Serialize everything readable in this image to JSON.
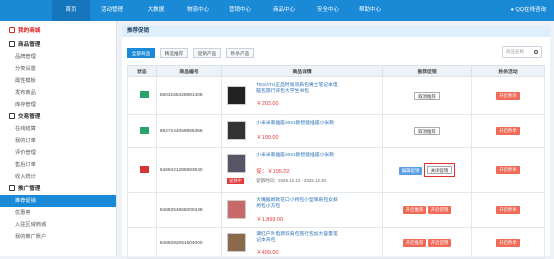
{
  "topnav": {
    "items": [
      "首页",
      "活动管理",
      "大数据",
      "物流中心",
      "营销中心",
      "商品中心",
      "安全中心",
      "帮助中心"
    ],
    "qq_label": "QQ在线咨询"
  },
  "sidebar": {
    "my_shop": "我的商城",
    "sections": [
      {
        "title": "商品管理",
        "items": [
          "品牌管理",
          "分类设置",
          "属性模板",
          "发布商品",
          "库存管理"
        ]
      },
      {
        "title": "交易管理",
        "items": [
          "在线结算",
          "我的订单",
          "评价管理",
          "售后订单",
          "收入统计"
        ]
      },
      {
        "title": "推广管理",
        "items": [
          "推荐促销",
          "优惠券",
          "入驻区域商城",
          "我的推广账户"
        ]
      }
    ]
  },
  "main": {
    "breadcrumb": "推荐促销",
    "tabs": [
      "全部商品",
      "精选推荐",
      "促销产品",
      "秒杀产品"
    ],
    "search_placeholder": "商品名称",
    "columns": [
      "状态",
      "商品编号",
      "商品详情",
      "推荐促销",
      "秒杀活动"
    ],
    "rows": [
      {
        "status": "green",
        "code": "6503165428881408",
        "name": "TEGATU正品时尚双肩包男士笔记本电脑包旅行背包大学生书包",
        "price": "￥203.00",
        "promo": "取消推荐",
        "seckill": "开启秒杀"
      },
      {
        "status": "green",
        "code": "8527244059866368",
        "name": "小米米家插座2021款智能插座小米款",
        "price": "￥199.00",
        "promo": "取消推荐",
        "seckill": "开启秒杀"
      },
      {
        "status": "red",
        "code": "6469421286883840",
        "name": "小米米家插座2021款智能插座小米款",
        "price": "促：￥195.02",
        "period": "促销时间：2025.12.13 - 2025.12.20",
        "tag": "促销中",
        "promo_label": "编辑促销",
        "promo": "关闭促销",
        "seckill": "开启秒杀"
      },
      {
        "status": "none",
        "code": "8468254865000448",
        "name": "大嘴猴新款花口小挎包小型单肩包女斜挎包小方包",
        "price": "￥1,899.00",
        "promo_a": "开启推荐",
        "promo_b": "开启促销",
        "seckill": "开启秒杀"
      },
      {
        "status": "none",
        "code": "8468292061604000",
        "name": "潮红户外电源双肩包旅行包加大容量笔记本背包",
        "price": "￥499.00",
        "promo_a": "开启推荐",
        "promo_b": "开启促销",
        "seckill": "开启秒杀"
      }
    ]
  }
}
